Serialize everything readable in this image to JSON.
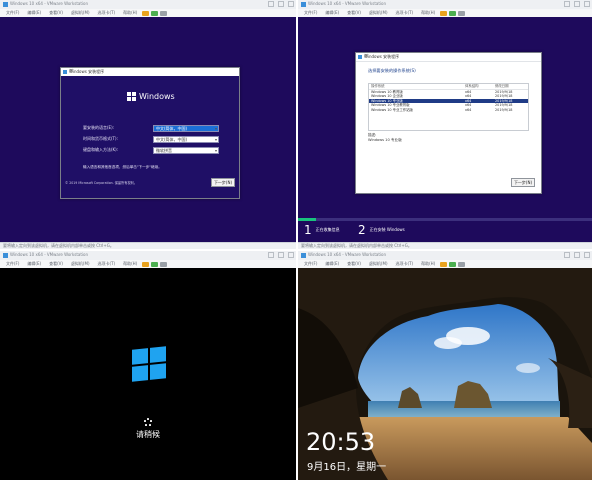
{
  "menu": [
    "文件(F)",
    "编辑(E)",
    "查看(V)",
    "虚拟机(M)",
    "选项卡(T)",
    "帮助(H)"
  ],
  "q1": {
    "title": "Windows 10 x64 - VMware Workstation",
    "setup": {
      "dialog_title": "Windows 安装程序",
      "brand": "Windows",
      "fields": [
        {
          "label": "要安装的语言(E):",
          "value": "中文(简体，中国)",
          "highlight": true
        },
        {
          "label": "时间和货币格式(T):",
          "value": "中文(简体，中国)",
          "highlight": false
        },
        {
          "label": "键盘和输入方法(K):",
          "value": "微软拼音",
          "highlight": false
        }
      ],
      "instructions": "输入语言和其他首选项，然后单击\"下一步\"继续。",
      "copyright": "© 2019 Microsoft Corporation. 保留所有权利。",
      "next_button": "下一步(N)"
    },
    "status": "要将输入定向到该虚拟机，请在虚拟机内部单击或按 Ctrl+G。"
  },
  "q2": {
    "title": "Windows 10 x64 - VMware Workstation",
    "setup": {
      "dialog_title": "Windows 安装程序",
      "heading": "选择要安装的操作系统(S)",
      "columns": [
        "操作系统",
        "体系结构",
        "修改日期"
      ],
      "rows": [
        [
          "Windows 10 教育版",
          "x64",
          "2019/9/18"
        ],
        [
          "Windows 10 企业版",
          "x64",
          "2019/9/18"
        ],
        [
          "Windows 10 专业版",
          "x64",
          "2019/9/18"
        ],
        [
          "Windows 10 专业教育版",
          "x64",
          "2019/9/18"
        ],
        [
          "Windows 10 专业工作站版",
          "x64",
          "2019/9/18"
        ]
      ],
      "selected_row": 2,
      "desc_label": "描述:",
      "desc_value": "Windows 10 专业版",
      "next_button": "下一步(N)"
    },
    "progress": {
      "fraction": 0.06,
      "steps": [
        {
          "num": "1",
          "label": "正在收集信息"
        },
        {
          "num": "2",
          "label": "正在安装 Windows"
        }
      ]
    },
    "status": "要将输入定向到该虚拟机，请在虚拟机内部单击或按 Ctrl+G。"
  },
  "q3": {
    "title": "Windows 10 x64 - VMware Workstation",
    "wait_text": "请稍候",
    "logo_color": "#1fa3f0"
  },
  "q4": {
    "title": "Windows 10 x64 - VMware Workstation",
    "time": "20:53",
    "date": "9月16日，星期一"
  }
}
